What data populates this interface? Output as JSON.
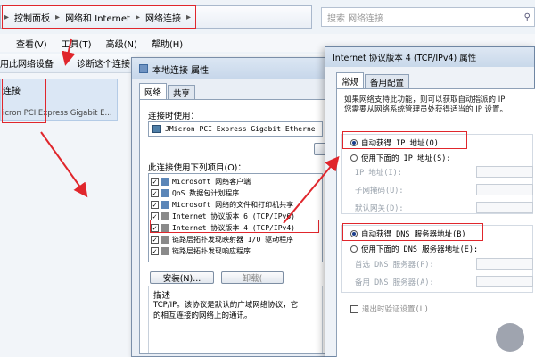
{
  "explorer": {
    "breadcrumb": [
      "控制面板",
      "网络和 Internet",
      "网络连接"
    ],
    "search_placeholder": "搜索 网络连接",
    "menu": [
      "查看(V)",
      "工具(T)",
      "高级(N)",
      "帮助(H)"
    ],
    "toolbar": [
      "用此网络设备",
      "诊断这个连接"
    ],
    "connection_name": "连接",
    "connection_adapter": "icron PCI Express Gigabit E..."
  },
  "dialog1": {
    "title": "本地连接 属性",
    "tabs": [
      "网络",
      "共享"
    ],
    "connect_using_label": "连接时使用：",
    "adapter": "JMicron PCI Express Gigabit Etherne",
    "items_label": "此连接使用下列项目(O)：",
    "items": [
      "Microsoft 网络客户端",
      "QoS 数据包计划程序",
      "Microsoft 网络的文件和打印机共享",
      "Internet 协议版本 6 (TCP/IPv6)",
      "Internet 协议版本 4 (TCP/IPv4)",
      "链路层拓扑发现映射器 I/O 驱动程序",
      "链路层拓扑发现响应程序"
    ],
    "install_button": "安装(N)...",
    "uninstall_button": "卸载(",
    "desc_title": "描述",
    "desc_text": "TCP/IP。该协议是默认的广域网络协议，它\n的相互连接的网络上的通讯。"
  },
  "dialog2": {
    "title": "Internet 协议版本 4 (TCP/IPv4) 属性",
    "tabs": [
      "常规",
      "备用配置"
    ],
    "intro": "如果网络支持此功能，则可以获取自动指派的 IP\n您需要从网络系统管理员处获得适当的 IP 设置。",
    "auto_ip": "自动获得 IP 地址(O)",
    "manual_ip": "使用下面的 IP 地址(S):",
    "ip_label": "IP 地址(I):",
    "mask_label": "子网掩码(U):",
    "gateway_label": "默认网关(D):",
    "auto_dns": "自动获得 DNS 服务器地址(B)",
    "manual_dns": "使用下面的 DNS 服务器地址(E):",
    "dns1_label": "首选 DNS 服务器(P):",
    "dns2_label": "备用 DNS 服务器(A):",
    "validate_label": "退出时验证设置(L)"
  },
  "colors": {
    "annotation": "#e0262c"
  }
}
